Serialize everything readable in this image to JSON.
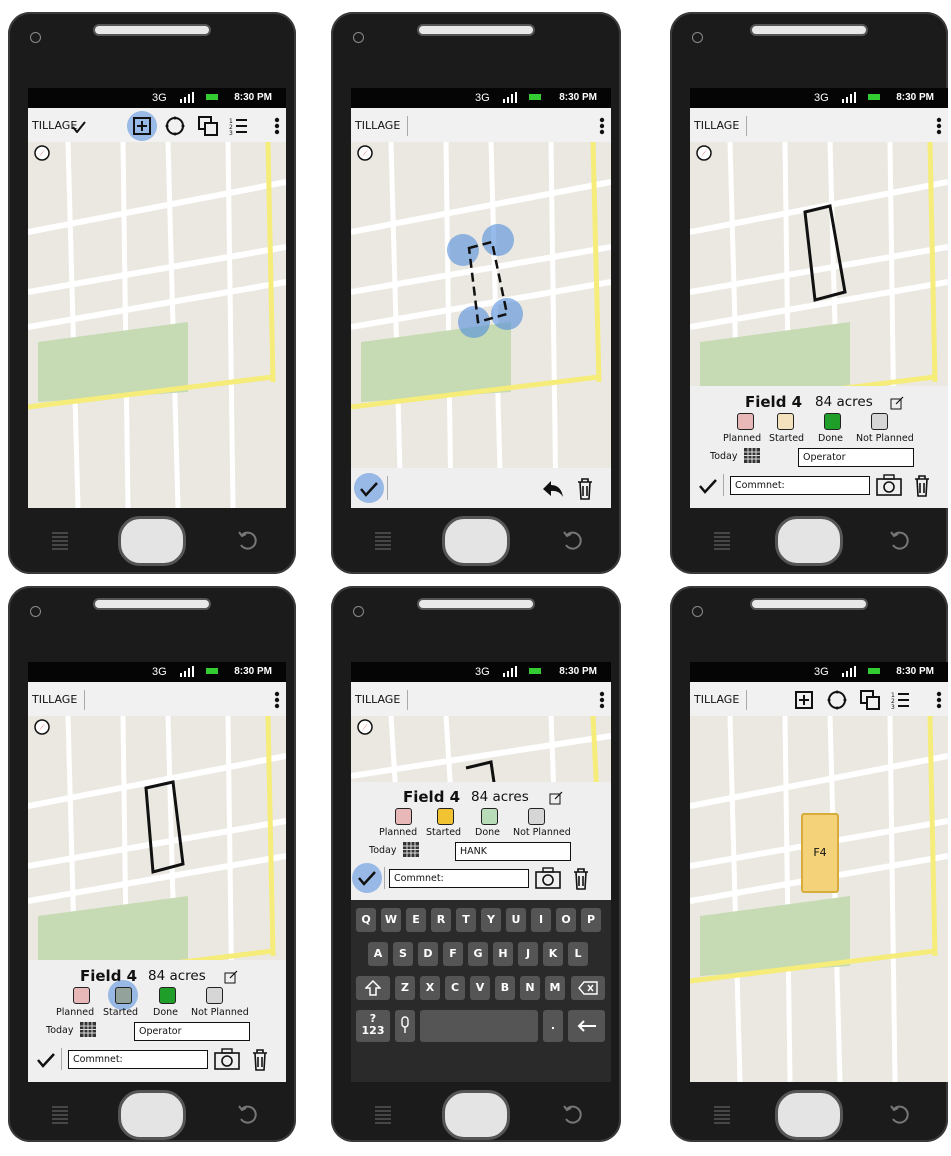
{
  "status": {
    "network": "3G",
    "time": "8:30 PM"
  },
  "app": {
    "title": "TILLAGE"
  },
  "icons": {
    "toolbar": [
      "add-field-icon",
      "draw-circle-icon",
      "copy-layers-icon",
      "list-icon"
    ],
    "menu": "overflow-menu-icon",
    "compass": "compass-icon"
  },
  "field": {
    "name": "Field 4",
    "acres": "84 acres",
    "today_label": "Today",
    "comment_placeholder": "Commnet:"
  },
  "statuses": [
    {
      "label": "Planned",
      "color": "#e8b7b7"
    },
    {
      "label": "Started",
      "color": "#f3e2bd"
    },
    {
      "label": "Done",
      "color": "#1f9e2a"
    },
    {
      "label": "Not Planned",
      "color": "#d6d6d6"
    }
  ],
  "statuses_screen4": [
    {
      "label": "Planned",
      "color": "#e8b7b7"
    },
    {
      "label": "Started",
      "color": "#93a39b"
    },
    {
      "label": "Done",
      "color": "#1f9e2a"
    },
    {
      "label": "Not Planned",
      "color": "#d6d6d6"
    }
  ],
  "statuses_screen5": [
    {
      "label": "Planned",
      "color": "#e8b7b7"
    },
    {
      "label": "Started",
      "color": "#f1c232"
    },
    {
      "label": "Done",
      "color": "#b7dcb7"
    },
    {
      "label": "Not Planned",
      "color": "#d6d6d6"
    }
  ],
  "operator": {
    "placeholder": "Operator",
    "value_screen5": "HANK"
  },
  "keyboard": {
    "row1": [
      "Q",
      "W",
      "E",
      "R",
      "T",
      "Y",
      "U",
      "I",
      "O",
      "P"
    ],
    "row2": [
      "A",
      "S",
      "D",
      "F",
      "G",
      "H",
      "J",
      "K",
      "L"
    ],
    "row3": [
      "Z",
      "X",
      "C",
      "V",
      "B",
      "N",
      "M"
    ],
    "numkey": "?\n123",
    "period": "."
  },
  "map_label": "F4",
  "colors": {
    "phone": "#1b1b1b",
    "highlight": "#6ea0e0",
    "road_yellow": "#f5ec7a",
    "park": "#c6dbb4"
  }
}
